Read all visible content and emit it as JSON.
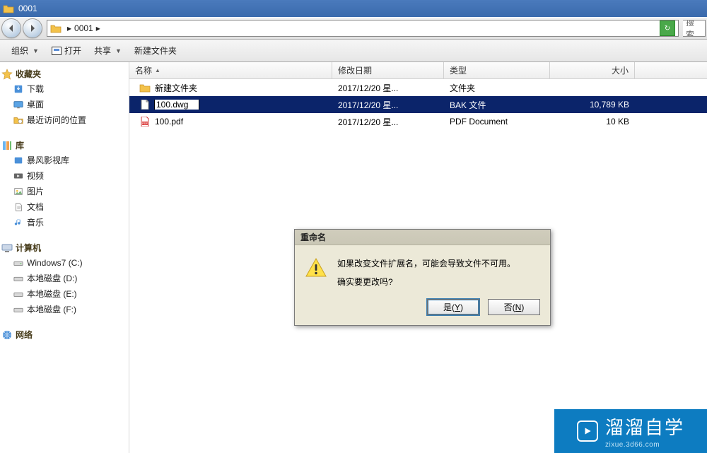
{
  "window": {
    "title": "0001"
  },
  "address": {
    "crumb": "0001"
  },
  "search": {
    "placeholder": "搜索"
  },
  "toolbar": {
    "organize": "组织",
    "open": "打开",
    "share": "共享",
    "new_folder": "新建文件夹"
  },
  "sidebar": {
    "favorites": {
      "label": "收藏夹",
      "items": [
        {
          "icon": "download",
          "label": "下载"
        },
        {
          "icon": "desktop",
          "label": "桌面"
        },
        {
          "icon": "recent",
          "label": "最近访问的位置"
        }
      ]
    },
    "libraries": {
      "label": "库",
      "items": [
        {
          "icon": "video-lib",
          "label": "暴风影视库"
        },
        {
          "icon": "video",
          "label": "视频"
        },
        {
          "icon": "pictures",
          "label": "图片"
        },
        {
          "icon": "documents",
          "label": "文档"
        },
        {
          "icon": "music",
          "label": "音乐"
        }
      ]
    },
    "computer": {
      "label": "计算机",
      "items": [
        {
          "icon": "drive-c",
          "label": "Windows7 (C:)"
        },
        {
          "icon": "drive",
          "label": "本地磁盘 (D:)"
        },
        {
          "icon": "drive",
          "label": "本地磁盘 (E:)"
        },
        {
          "icon": "drive",
          "label": "本地磁盘 (F:)"
        }
      ]
    },
    "network": {
      "label": "网络"
    }
  },
  "columns": {
    "name": "名称",
    "date": "修改日期",
    "type": "类型",
    "size": "大小"
  },
  "files": [
    {
      "icon": "folder",
      "name": "新建文件夹",
      "date": "2017/12/20 星...",
      "type": "文件夹",
      "size": "",
      "selected": false,
      "renaming": false
    },
    {
      "icon": "file",
      "name": "100.dwg",
      "date": "2017/12/20 星...",
      "type": "BAK 文件",
      "size": "10,789 KB",
      "selected": true,
      "renaming": true
    },
    {
      "icon": "pdf",
      "name": "100.pdf",
      "date": "2017/12/20 星...",
      "type": "PDF Document",
      "size": "10 KB",
      "selected": false,
      "renaming": false
    }
  ],
  "dialog": {
    "title": "重命名",
    "line1": "如果改变文件扩展名，可能会导致文件不可用。",
    "line2": "确实要更改吗?",
    "yes_pre": "是(",
    "yes_u": "Y",
    "yes_post": ")",
    "no_pre": "否(",
    "no_u": "N",
    "no_post": ")"
  },
  "watermark": {
    "main": "溜溜自学",
    "sub": "zixue.3d66.com"
  }
}
